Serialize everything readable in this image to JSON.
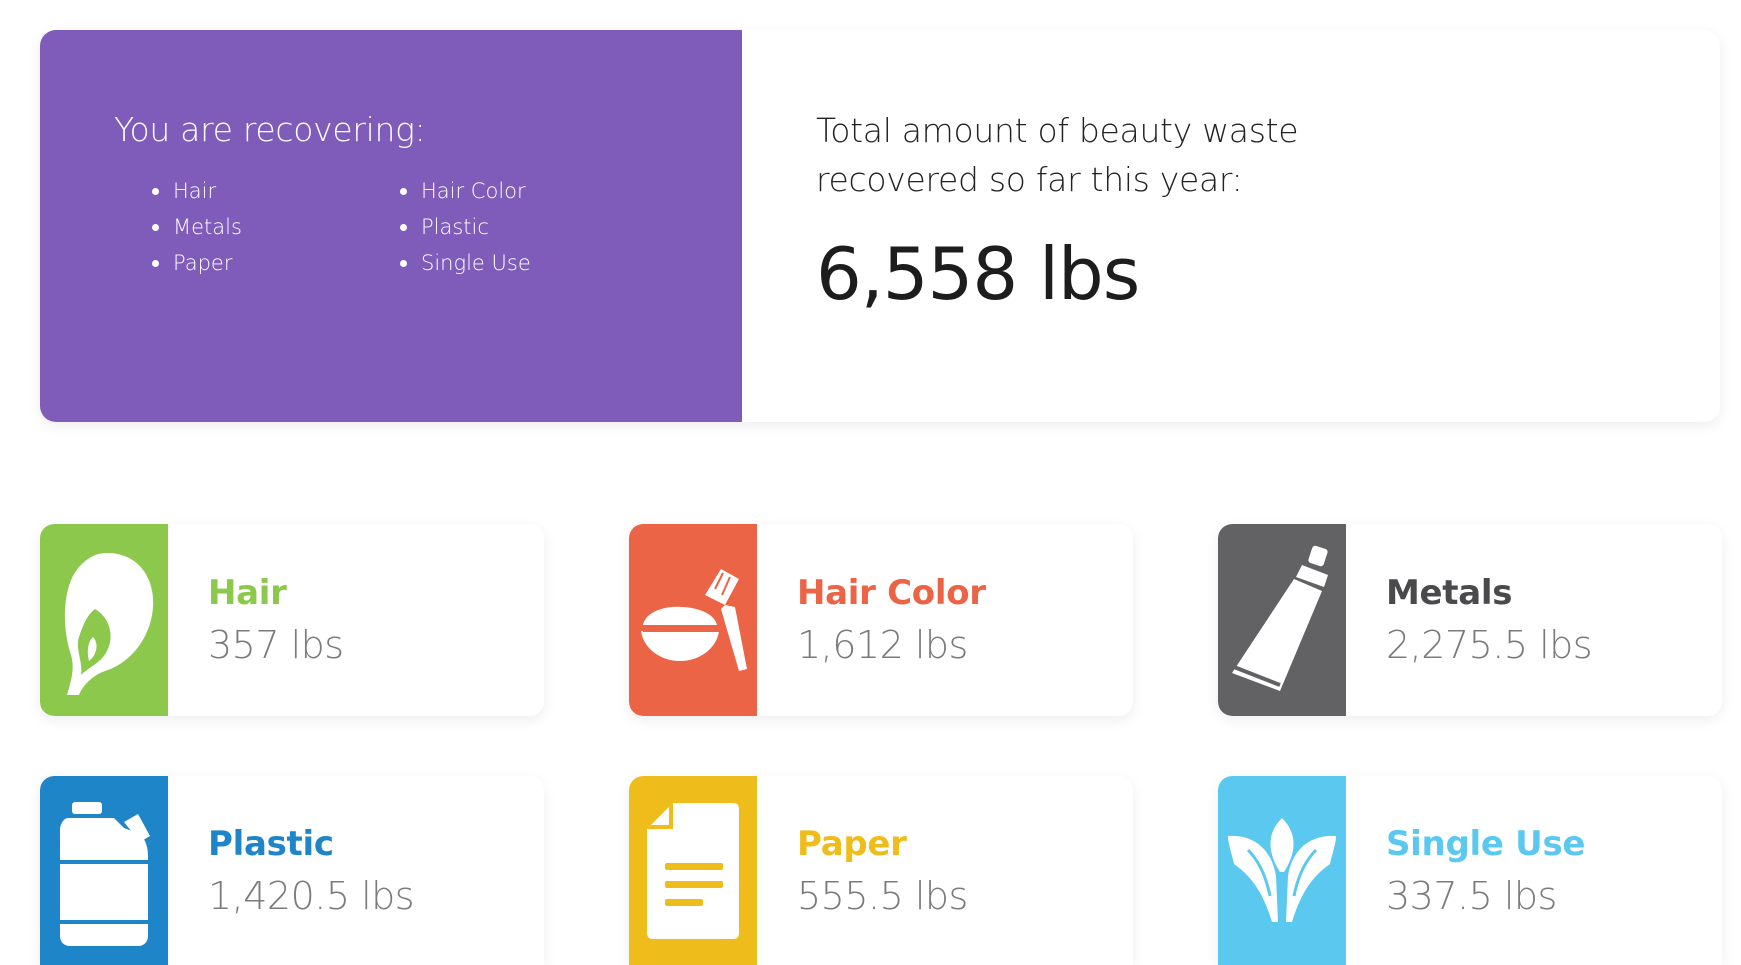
{
  "summary": {
    "recover_title": "You are recovering:",
    "recover_items": [
      "Hair",
      "Metals",
      "Paper",
      "Hair Color",
      "Plastic",
      "Single Use"
    ],
    "total_label": "Total amount of beauty waste recovered so far this year:",
    "total_value": "6,558 lbs",
    "panel_color": "#805cba"
  },
  "categories": [
    {
      "name": "Hair",
      "amount": "357 lbs",
      "color": "#8cc84b",
      "icon": "hair-head-icon"
    },
    {
      "name": "Hair Color",
      "amount": "1,612 lbs",
      "color": "#ea6445",
      "icon": "hair-dye-bowl-brush-icon"
    },
    {
      "name": "Metals",
      "amount": "2,275.5 lbs",
      "color": "#626264",
      "icon": "metal-tube-icon"
    },
    {
      "name": "Plastic",
      "amount": "1,420.5 lbs",
      "color": "#1e85c8",
      "icon": "plastic-jug-icon"
    },
    {
      "name": "Paper",
      "amount": "555.5 lbs",
      "color": "#eebd1c",
      "icon": "paper-document-icon"
    },
    {
      "name": "Single Use",
      "amount": "337.5 lbs",
      "color": "#5bc8ef",
      "icon": "leaf-sprout-icon"
    }
  ]
}
